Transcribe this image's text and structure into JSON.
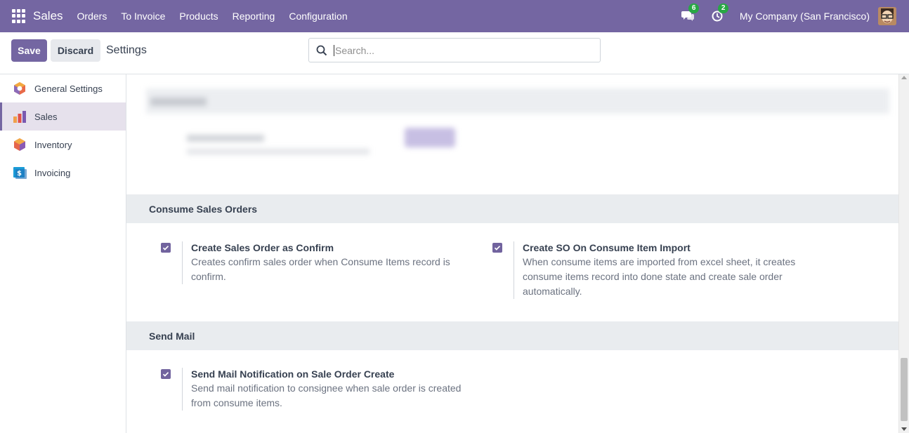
{
  "navbar": {
    "app_name": "Sales",
    "menu": [
      "Orders",
      "To Invoice",
      "Products",
      "Reporting",
      "Configuration"
    ],
    "messages_badge": "6",
    "activities_badge": "2",
    "company": "My Company (San Francisco)",
    "badge_color": "#28a745",
    "brand_color": "#7466a2"
  },
  "control": {
    "save_label": "Save",
    "discard_label": "Discard",
    "title": "Settings",
    "search_placeholder": "Search..."
  },
  "sidebar": {
    "items": [
      {
        "label": "General Settings",
        "icon": "general-settings-icon",
        "active": false
      },
      {
        "label": "Sales",
        "icon": "sales-app-icon",
        "active": true
      },
      {
        "label": "Inventory",
        "icon": "inventory-app-icon",
        "active": false
      },
      {
        "label": "Invoicing",
        "icon": "invoicing-app-icon",
        "active": false
      }
    ]
  },
  "main": {
    "sections": [
      {
        "title": "Consume Sales Orders",
        "settings": [
          {
            "title": "Create Sales Order as Confirm",
            "desc": "Creates confirm sales order when Consume Items record is confirm.",
            "checked": true
          },
          {
            "title": "Create SO On Consume Item Import",
            "desc": "When consume items are imported from excel sheet, it creates consume items record into done state and create sale order automatically.",
            "checked": true
          }
        ]
      },
      {
        "title": "Send Mail",
        "settings": [
          {
            "title": "Send Mail Notification on Sale Order Create",
            "desc": "Send mail notification to consignee when sale order is created from consume items.",
            "checked": true
          }
        ]
      }
    ]
  }
}
